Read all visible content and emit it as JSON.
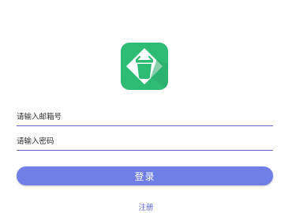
{
  "app": {
    "logo_icon": "trash-can-icon",
    "logo_color": "#2ebc74"
  },
  "form": {
    "email_placeholder": "请输入邮箱号",
    "email_value": "",
    "password_placeholder": "请输入密码",
    "password_value": "",
    "login_label": "登录",
    "register_label": "注册"
  },
  "colors": {
    "accent": "#6f7fe6",
    "underline": "#5b63c9",
    "link": "#5a64d8"
  }
}
